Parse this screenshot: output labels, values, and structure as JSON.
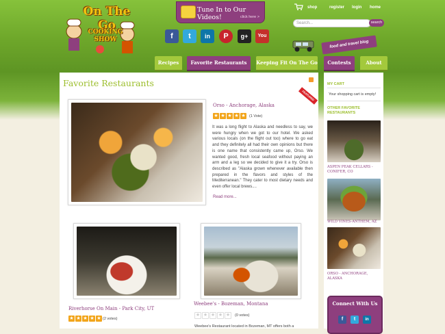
{
  "logo": {
    "line1": "On The Go",
    "line2": "COOKING",
    "line3": "SHOW"
  },
  "header": {
    "videos_title": "Tune In to Our Videos!",
    "videos_sub": "click here >",
    "links": {
      "shop": "shop",
      "register": "register",
      "login": "login",
      "home": "home"
    },
    "search_placeholder": "Search...",
    "search_button": "search",
    "blog_tag": "food and travel blog",
    "social": [
      {
        "name": "facebook",
        "glyph": "f",
        "color": "#3b5998"
      },
      {
        "name": "twitter",
        "glyph": "t",
        "color": "#33a9dc"
      },
      {
        "name": "linkedin",
        "glyph": "in",
        "color": "#0e76a8"
      },
      {
        "name": "pinterest",
        "glyph": "P",
        "color": "#c8232c"
      },
      {
        "name": "google-plus",
        "glyph": "g+",
        "color": "#222222"
      },
      {
        "name": "youtube",
        "glyph": "You",
        "color": "#c4302b"
      }
    ]
  },
  "nav": [
    "Recipes",
    "Favorite Restaurants",
    "Keeping Fit On The Go",
    "Contests",
    "About"
  ],
  "main": {
    "title": "Favorite Restaurants",
    "featured_badge": "FEATURED",
    "featured": {
      "title": "Orso - Anchorage, Alaska",
      "rating": 5,
      "votes": "(1 Vote)",
      "description": "It was a long flight to Alaska and needless to say, we were hungry when we got to our hotel. We asked various locals (on the flight out too) where to go eat and they definitely all had their own opinions but there is one name that consistently came up, Orso. We wanted good, fresh local seafood without paying an arm and a leg so we decided to give it a try. Orso is described as \"Alaska grown whenever available then prepared in the flavors and styles of the Mediterranean.\" They cater to most dietary needs and even offer local brews....",
      "read_more": "Read more..."
    },
    "cards": [
      {
        "title": "Riverhorse On Main - Park City, UT",
        "rating": 5,
        "votes": "(2 votes)"
      },
      {
        "title": "Weebee's - Bozeman, Montana",
        "rating": 0,
        "votes": "(0 votes)"
      }
    ],
    "teaser": "Weebee's Restaurant located in Bozeman, MT offers both a"
  },
  "sidebar": {
    "cart_heading": "MY CART",
    "cart_text": "Your shopping cart is empty!",
    "other_heading_1": "OTHER FAVORITE",
    "other_heading_2": "RESTAURANTS",
    "items": [
      {
        "caption_1": "ASPEN PEAK CELLARS -",
        "caption_2": "CONIFER, CO"
      },
      {
        "caption_1": "WILD VINES-ANTHEM, AZ",
        "caption_2": ""
      },
      {
        "caption_1": "ORSO - ANCHORAGE,",
        "caption_2": "ALASKA"
      }
    ],
    "connect_title": "Connect With Us"
  }
}
